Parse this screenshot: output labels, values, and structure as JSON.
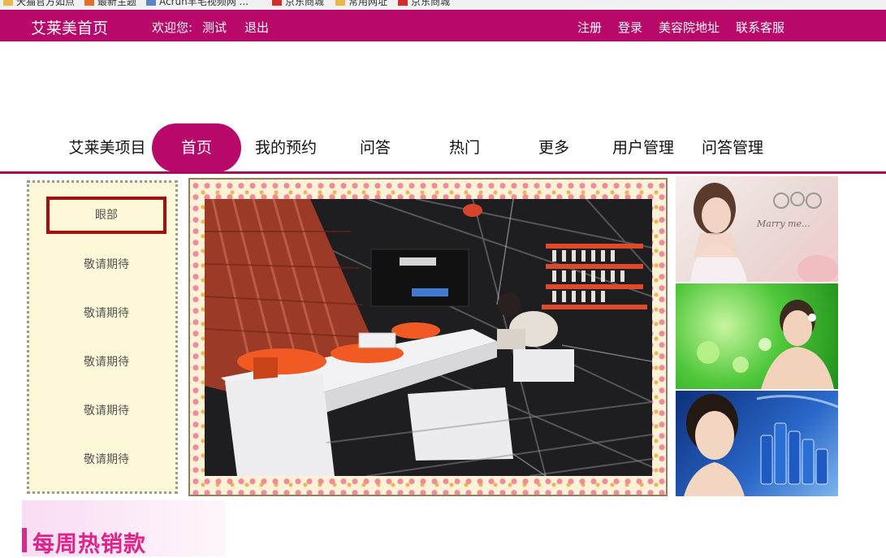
{
  "bookmarks": [
    {
      "label": "天猫官方如点",
      "icon": "folder-icon"
    },
    {
      "label": "最新主题",
      "icon": "fire-icon"
    },
    {
      "label": "Acrun羊毛视频网 ...",
      "icon": "picture-icon"
    },
    {
      "label": "京东商城",
      "icon": "jd-icon"
    },
    {
      "label": "常用网址",
      "icon": "folder-icon"
    },
    {
      "label": "京东商城",
      "icon": "jd-icon"
    }
  ],
  "topbar": {
    "home": "艾莱美首页",
    "welcome": "欢迎您:",
    "username": "测试",
    "logout": "退出",
    "register": "注册",
    "login": "登录",
    "address": "美容院地址",
    "service": "联系客服"
  },
  "nav": {
    "items": [
      "艾莱美项目",
      "首页",
      "我的预约",
      "问答",
      "热门",
      "更多",
      "用户管理",
      "问答管理"
    ],
    "active_index": 1
  },
  "sidemenu": {
    "items": [
      "眼部",
      "敬请期待",
      "敬请期待",
      "敬请期待",
      "敬请期待",
      "敬请期待"
    ],
    "active_index": 0
  },
  "ads": {
    "ad1_script": "Marry me..."
  },
  "weekly_banner": "每周热销款",
  "colors": {
    "brand": "#b8086a",
    "side_bg": "#fdf8d8",
    "active_border": "#a30f0f",
    "banner_text": "#e0238b"
  }
}
